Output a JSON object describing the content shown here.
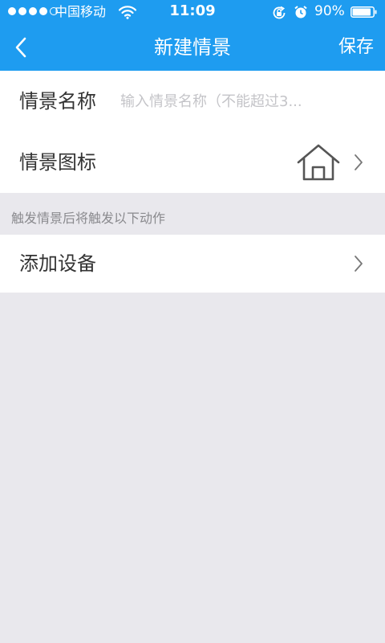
{
  "status_bar": {
    "carrier": "中国移动",
    "time": "11:09",
    "battery": "90%",
    "battery_level": 0.9,
    "signal_bars_filled": 4,
    "signal_bars_total": 5,
    "icons": [
      "wifi-icon",
      "rotation-lock-icon",
      "alarm-icon",
      "battery-icon"
    ]
  },
  "nav": {
    "back_icon": "chevron-left-icon",
    "title": "新建情景",
    "save_label": "保存"
  },
  "form": {
    "name": {
      "label": "情景名称",
      "value": "",
      "placeholder": "输入情景名称（不能超过3..."
    },
    "icon": {
      "label": "情景图标",
      "value_icon": "home-icon",
      "chevron_icon": "chevron-right-icon"
    }
  },
  "actions": {
    "caption": "触发情景后将触发以下动作",
    "add_device_label": "添加设备",
    "chevron_icon": "chevron-right-icon"
  },
  "colors": {
    "nav_background": "#1e9cf0",
    "page_background": "#e9e8ed",
    "row_background": "#ffffff",
    "label_text": "#333333",
    "placeholder_text": "#c4c4c8",
    "caption_text": "#8a8a8e"
  }
}
